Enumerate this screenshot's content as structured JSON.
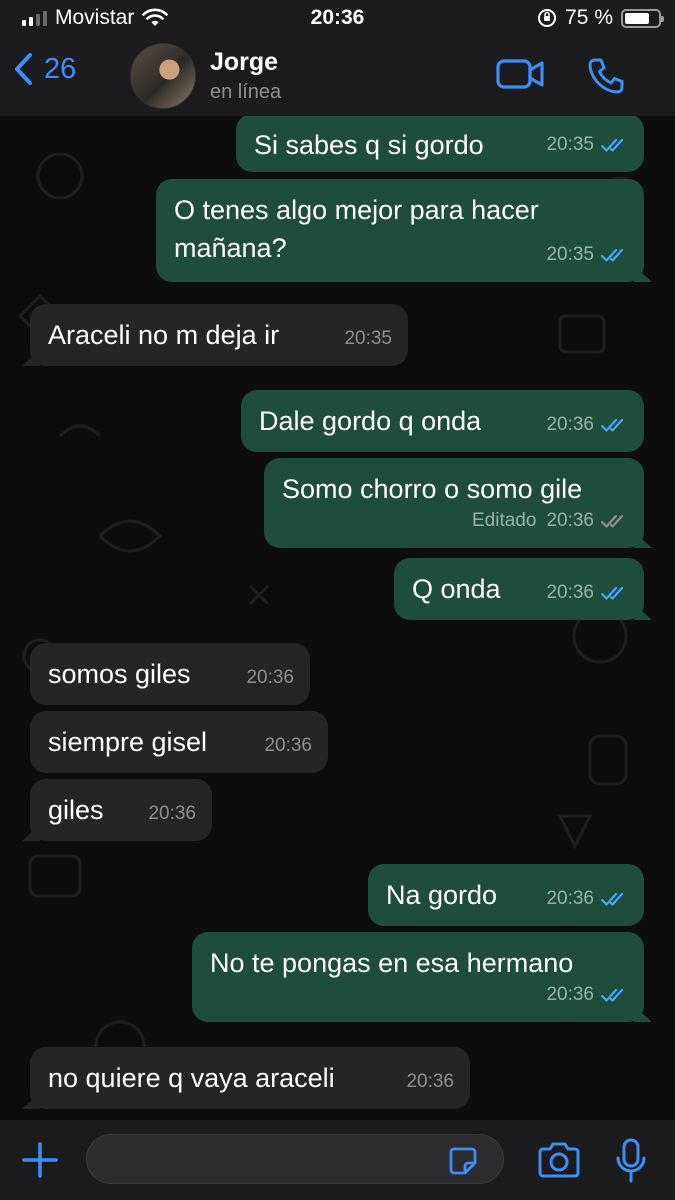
{
  "status_bar": {
    "carrier": "Movistar",
    "time": "20:36",
    "battery_percent": "75 %",
    "battery_level": 0.75,
    "signal_bars": 2
  },
  "header": {
    "back_count": "26",
    "contact_name": "Jorge",
    "contact_status": "en línea",
    "accent_color": "#3e8ef7"
  },
  "messages": [
    {
      "dir": "out",
      "text": "Si sabes q si gordo",
      "time": "20:35",
      "status": "read"
    },
    {
      "dir": "out",
      "text": "O tenes algo mejor para hacer mañana?",
      "time": "20:35",
      "status": "read"
    },
    {
      "dir": "in",
      "text": "Araceli no m deja ir",
      "time": "20:35"
    },
    {
      "dir": "out",
      "text": "Dale gordo q onda",
      "time": "20:36",
      "status": "read"
    },
    {
      "dir": "out",
      "text": "Somo chorro o somo gile",
      "time": "20:36",
      "edited": "Editado",
      "status": "delivered"
    },
    {
      "dir": "out",
      "text": "Q onda",
      "time": "20:36",
      "status": "read"
    },
    {
      "dir": "in",
      "text": "somos giles",
      "time": "20:36"
    },
    {
      "dir": "in",
      "text": "siempre gisel",
      "time": "20:36"
    },
    {
      "dir": "in",
      "text": "giles",
      "time": "20:36"
    },
    {
      "dir": "out",
      "text": "Na gordo",
      "time": "20:36",
      "status": "read"
    },
    {
      "dir": "out",
      "text": "No te pongas en esa hermano",
      "time": "20:36",
      "status": "read"
    },
    {
      "dir": "in",
      "text": "no quiere q vaya araceli",
      "time": "20:36"
    }
  ],
  "colors": {
    "outgoing_bubble": "#1e4d3c",
    "incoming_bubble": "#252525",
    "read_tick": "#4aa3ff",
    "delivered_tick": "#8e8e93"
  },
  "icons": [
    "back-chevron-icon",
    "video-call-icon",
    "phone-icon",
    "plus-icon",
    "sticker-icon",
    "camera-icon",
    "microphone-icon"
  ]
}
